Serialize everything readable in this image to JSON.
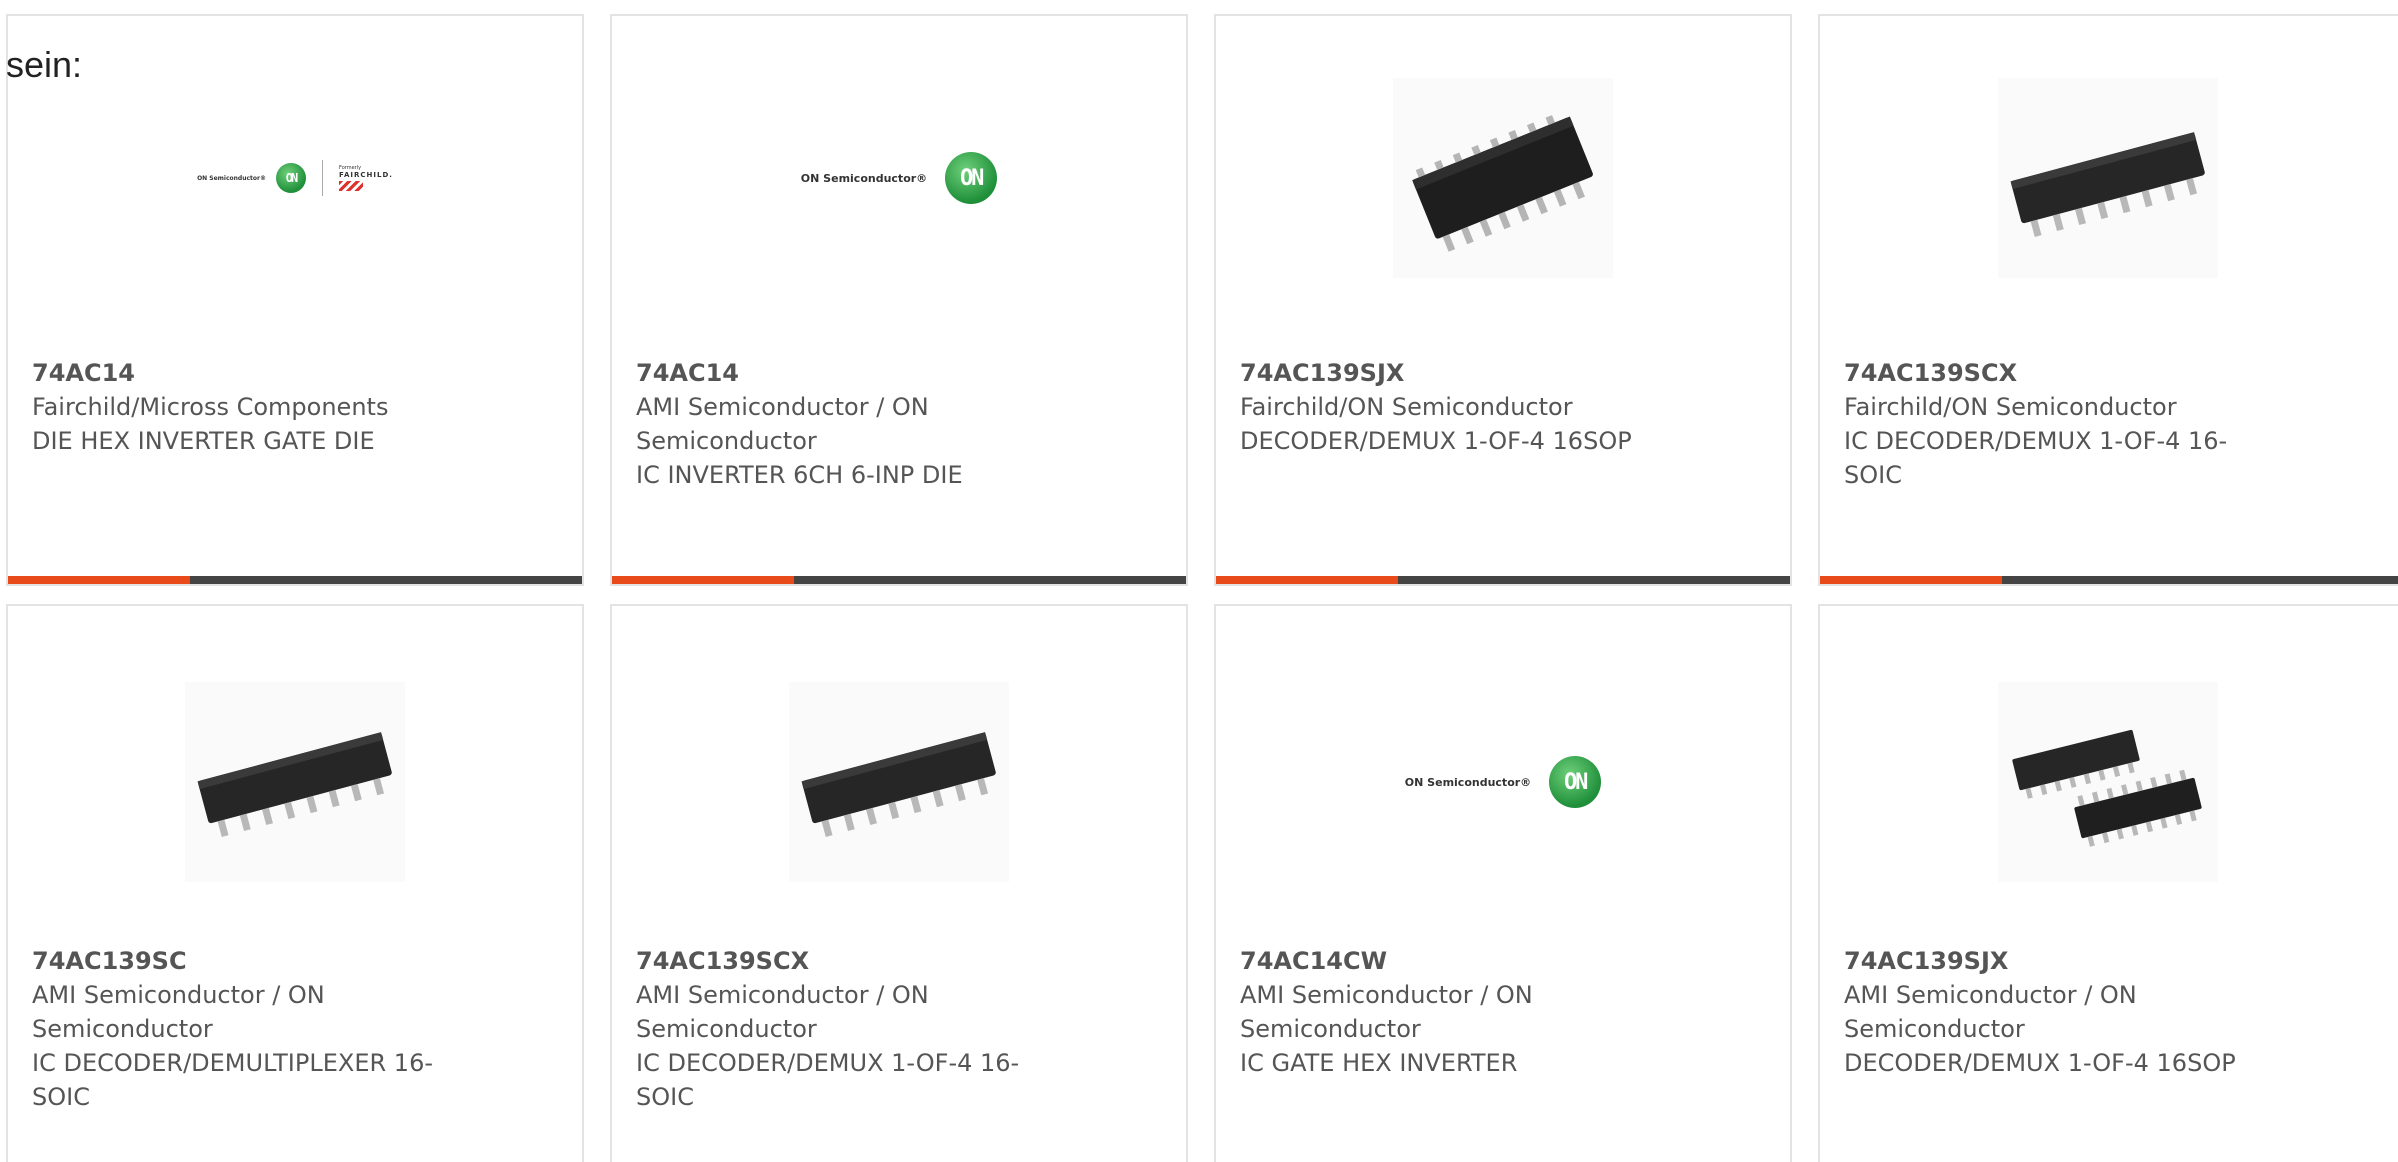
{
  "intro_text": "sein:",
  "cards": [
    {
      "part": "74AC14",
      "manufacturer": "Fairchild/Micross Components",
      "description": "DIE HEX INVERTER GATE DIE",
      "image_icon": "on-fairchild-logo"
    },
    {
      "part": "74AC14",
      "manufacturer": "AMI Semiconductor / ON Semiconductor",
      "description": "IC INVERTER 6CH 6-INP DIE",
      "image_icon": "on-semiconductor-logo"
    },
    {
      "part": "74AC139SJX",
      "manufacturer": "Fairchild/ON Semiconductor",
      "description": "DECODER/DEMUX 1-OF-4 16SOP",
      "image_icon": "sop16-chip-photo"
    },
    {
      "part": "74AC139SCX",
      "manufacturer": "Fairchild/ON Semiconductor",
      "description": "IC DECODER/DEMUX 1-OF-4 16-SOIC",
      "image_icon": "soic16-chip-photo"
    },
    {
      "part": "74AC139SC",
      "manufacturer": "AMI Semiconductor / ON Semiconductor",
      "description": "IC DECODER/DEMULTIPLEXER 16-SOIC",
      "image_icon": "soic16-chip-photo"
    },
    {
      "part": "74AC139SCX",
      "manufacturer": "AMI Semiconductor / ON Semiconductor",
      "description": "IC DECODER/DEMUX 1-OF-4 16-SOIC",
      "image_icon": "soic16-chip-photo"
    },
    {
      "part": "74AC14CW",
      "manufacturer": "AMI Semiconductor / ON Semiconductor",
      "description": "IC GATE HEX INVERTER",
      "image_icon": "on-semiconductor-logo"
    },
    {
      "part": "74AC139SJX",
      "manufacturer": "AMI Semiconductor / ON Semiconductor",
      "description": "DECODER/DEMUX 1-OF-4 16SOP",
      "image_icon": "two-soic-chips-photo"
    }
  ],
  "logos": {
    "on_text": "ON Semiconductor®",
    "on_mark": "ON",
    "fairchild_small": "Formerly",
    "fairchild_big": "FAIRCHILD."
  },
  "colors": {
    "accent_bar": "#e84a1a",
    "base_bar": "#444444",
    "text": "#555555",
    "on_green": "#1f8f3a"
  }
}
